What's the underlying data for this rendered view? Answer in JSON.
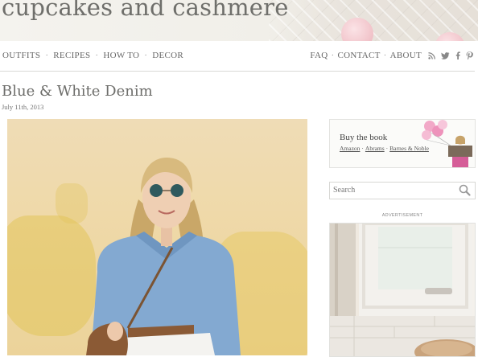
{
  "site": {
    "title": "cupcakes and cashmere"
  },
  "nav": {
    "left": [
      "OUTFITS",
      "RECIPES",
      "HOW TO",
      "DECOR"
    ],
    "right": [
      "FAQ",
      "CONTACT",
      "ABOUT"
    ],
    "social_icons": [
      "rss-icon",
      "twitter-icon",
      "facebook-icon",
      "pinterest-icon"
    ]
  },
  "post": {
    "title": "Blue & White Denim",
    "date": "July 11th, 2013"
  },
  "sidebar": {
    "book": {
      "heading": "Buy the book",
      "links": [
        "Amazon",
        "Abrams",
        "Barnes & Noble"
      ]
    },
    "search": {
      "placeholder": "Search"
    },
    "ad_label": "ADVERTISEMENT"
  },
  "colors": {
    "header_bg": "#f1efe9",
    "text": "#6d6d6a",
    "wall_yellow": "#ecd39a",
    "denim": "#7fa6cf"
  }
}
